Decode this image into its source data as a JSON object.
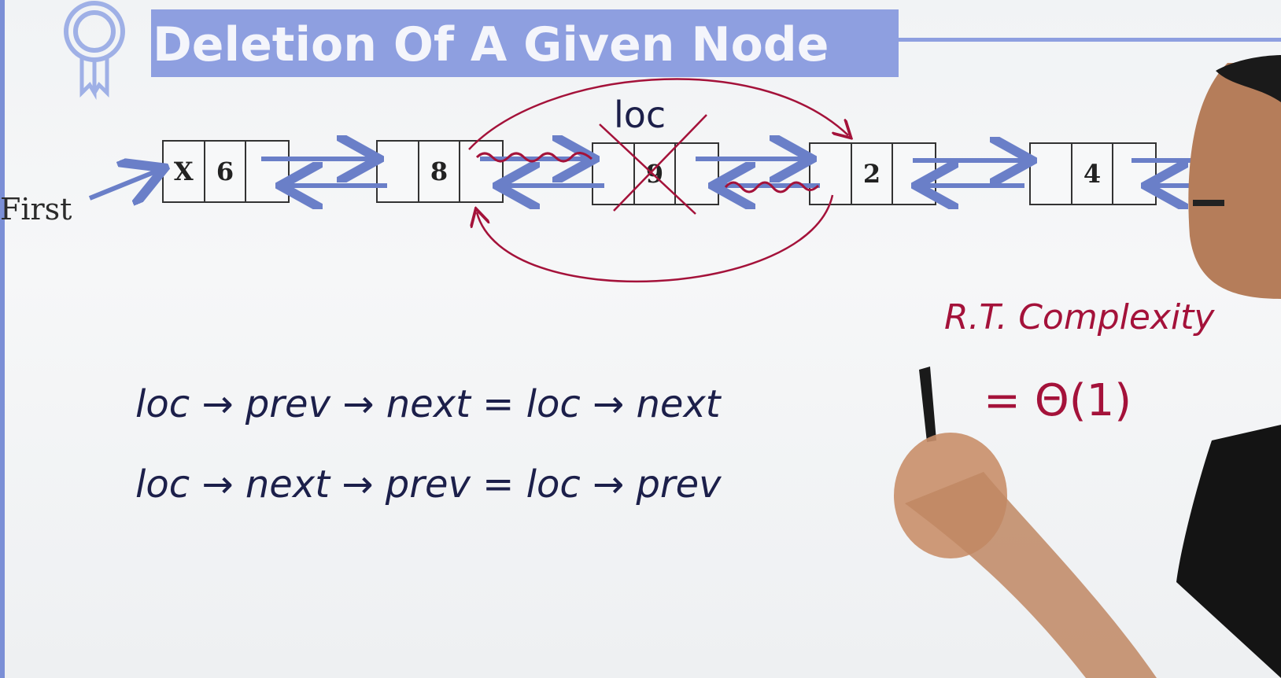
{
  "title": "Deletion Of A Given Node",
  "first_label": "First",
  "nodes": [
    {
      "prev": "X",
      "data": "6",
      "next": ""
    },
    {
      "prev": "",
      "data": "8",
      "next": ""
    },
    {
      "prev": "",
      "data": "9",
      "next": ""
    },
    {
      "prev": "",
      "data": "2",
      "next": ""
    },
    {
      "prev": "",
      "data": "4",
      "next": ""
    }
  ],
  "loc_label": "loc",
  "code_lines": [
    "loc → prev → next = loc → next",
    "loc → next → prev = loc → prev"
  ],
  "complexity_label": "R.T. Complexity",
  "complexity_value": "= Θ(1)",
  "colors": {
    "title_bg": "#8e9fe0",
    "arrow": "#6a7fc8",
    "ink_red": "#a4123a",
    "ink_blue": "#1c1f4a"
  }
}
